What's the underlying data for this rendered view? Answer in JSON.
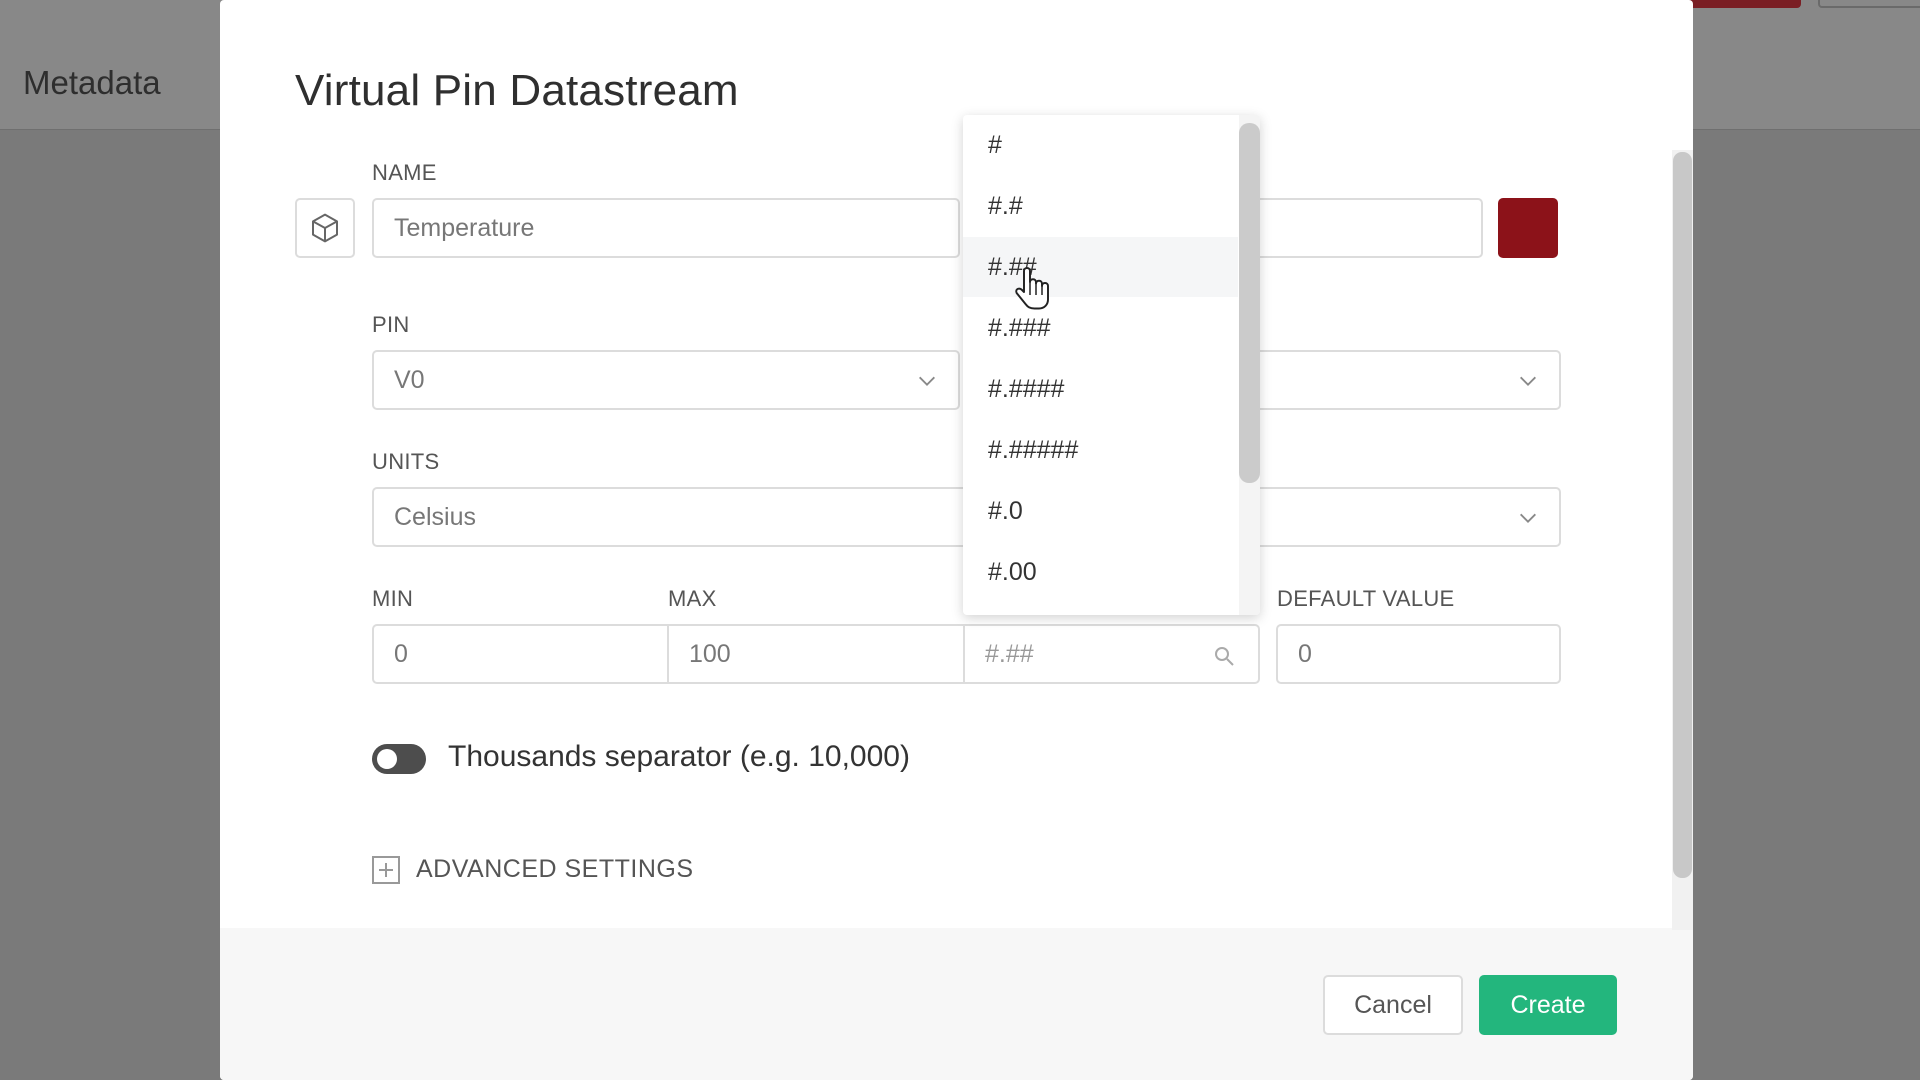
{
  "background": {
    "tab_label": "Metadata"
  },
  "modal": {
    "title": "Virtual Pin Datastream",
    "name": {
      "label": "NAME",
      "value": "Temperature"
    },
    "pin": {
      "label": "PIN",
      "value": "V0"
    },
    "units": {
      "label": "UNITS",
      "value": "Celsius"
    },
    "min": {
      "label": "MIN",
      "value": "0"
    },
    "max": {
      "label": "MAX",
      "value": "100"
    },
    "decimals": {
      "value": "#.##"
    },
    "default_value": {
      "label": "DEFAULT VALUE",
      "value": "0"
    },
    "color": "#8c1219",
    "toggle": {
      "label": "Thousands separator (e.g. 10,000)",
      "on": false
    },
    "advanced_label": "ADVANCED SETTINGS",
    "cancel_label": "Cancel",
    "create_label": "Create"
  },
  "dropdown": {
    "items": [
      "#",
      "#.#",
      "#.##",
      "#.###",
      "#.####",
      "#.#####",
      "#.0",
      "#.00"
    ],
    "hovered": "#.##"
  },
  "colors": {
    "accent": "#23b67d",
    "swatch": "#8c1219"
  },
  "icons": {
    "name_icon": "cube-icon",
    "select": "chevron-down-icon",
    "search": "search-icon",
    "advanced": "plus-square-icon"
  }
}
